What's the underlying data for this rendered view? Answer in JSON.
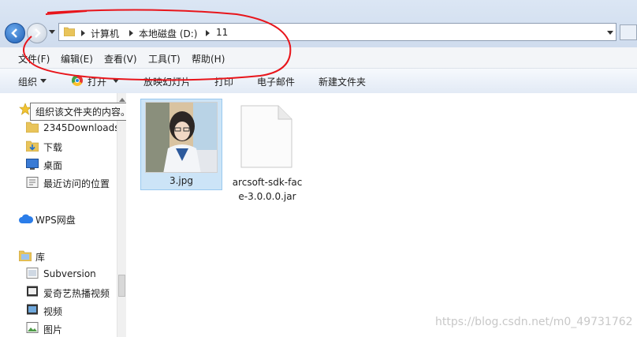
{
  "address": {
    "crumbs": [
      "计算机",
      "本地磁盘 (D:)",
      "11"
    ]
  },
  "menu": [
    "文件(F)",
    "编辑(E)",
    "查看(V)",
    "工具(T)",
    "帮助(H)"
  ],
  "toolbar": {
    "organize": "组织",
    "open": "打开",
    "slideshow": "放映幻灯片",
    "print": "打印",
    "email": "电子邮件",
    "new_folder": "新建文件夹"
  },
  "nav": {
    "tooltip": "组织该文件夹的内容。",
    "items": [
      "2345Downloads",
      "下载",
      "桌面",
      "最近访问的位置",
      "WPS网盘",
      "库",
      "Subversion",
      "爱奇艺热播视频",
      "视频",
      "图片"
    ]
  },
  "files": [
    {
      "name": "3.jpg",
      "icon": "image-thumbnail",
      "selected": true
    },
    {
      "name": "arcsoft-sdk-face-3.0.0.0.jar",
      "line1": "arcsoft-sdk-fac",
      "line2": "e-3.0.0.0.jar",
      "icon": "blank-file-icon"
    }
  ],
  "watermark": "https://blog.csdn.net/m0_49731762",
  "colors": {
    "selection": "#cce4f7",
    "annotation": "#e8151b",
    "accent": "#1f5fb5"
  }
}
